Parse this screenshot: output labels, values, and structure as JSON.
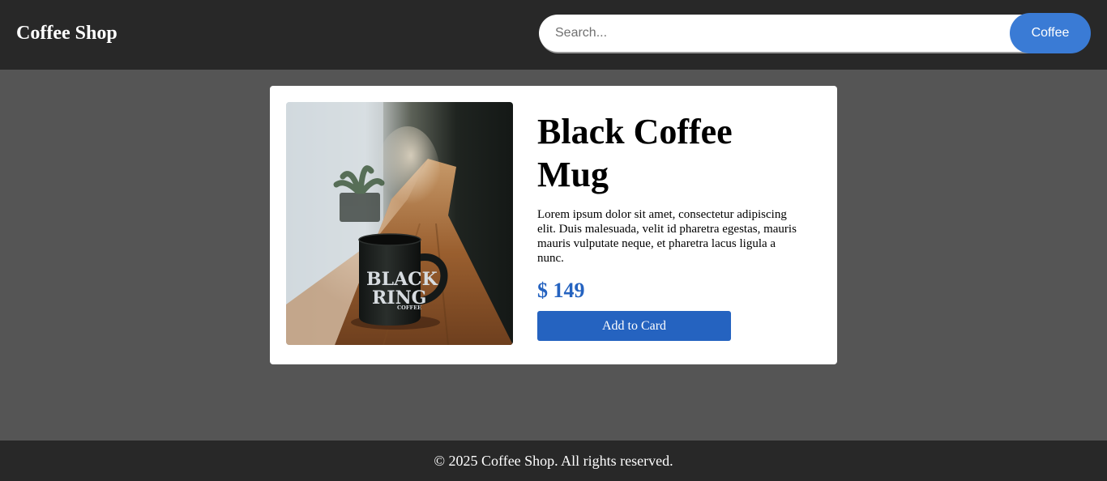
{
  "header": {
    "brand": "Coffee Shop",
    "search_placeholder": "Search...",
    "search_value": "",
    "search_button_label": "Coffee"
  },
  "product": {
    "image_alt": "Black mug with Black Ring Coffee logo on a wooden shelf",
    "mug_logo_line1": "BLACK",
    "mug_logo_line2": "RING",
    "mug_logo_line3": "COFFEE",
    "title": "Black Coffee Mug",
    "description": "Lorem ipsum dolor sit amet, consectetur adipiscing elit. Duis malesuada, velit id pharetra egestas, mauris mauris vulputate neque, et pharetra lacus ligula a nunc.",
    "price": "$ 149",
    "add_button_label": "Add to Card"
  },
  "footer": {
    "text": "© 2025 Coffee Shop. All rights reserved."
  },
  "colors": {
    "header_bg": "#282828",
    "page_bg": "#555555",
    "accent": "#2563c0",
    "search_button": "#3a7bd5"
  }
}
